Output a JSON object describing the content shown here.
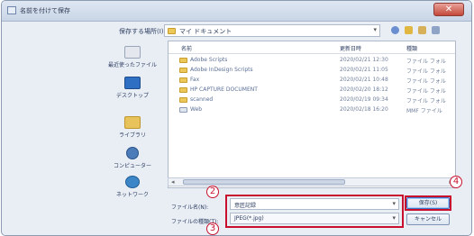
{
  "dialog": {
    "title": "名前を付けて保存",
    "close_label": "✕"
  },
  "toolbar": {
    "save_in_label": "保存する場所(I):",
    "location": "マイ ドキュメント",
    "icons": [
      "back-icon",
      "up-folder-icon",
      "new-folder-icon",
      "views-icon"
    ]
  },
  "places": [
    {
      "icon": "recent-icon",
      "label": "最近使ったファイル"
    },
    {
      "icon": "desktop-icon",
      "label": "デスクトップ"
    },
    {
      "icon": "library-icon",
      "label": "ライブラリ"
    },
    {
      "icon": "computer-icon",
      "label": "コンピューター"
    },
    {
      "icon": "network-icon",
      "label": "ネットワーク"
    }
  ],
  "filelist": {
    "columns": {
      "name": "名前",
      "date": "更新日時",
      "type": "種類"
    },
    "rows": [
      {
        "name": "Adobe Scripts",
        "date": "2020/02/21 12:30",
        "type": "ファイル フォル"
      },
      {
        "name": "Adobe InDesign Scripts",
        "date": "2020/02/21 11:05",
        "type": "ファイル フォル"
      },
      {
        "name": "Fax",
        "date": "2020/02/21 10:48",
        "type": "ファイル フォル"
      },
      {
        "name": "HP CAPTURE DOCUMENT",
        "date": "2020/02/20 18:12",
        "type": "ファイル フォル"
      },
      {
        "name": "scanned",
        "date": "2020/02/19 09:34",
        "type": "ファイル フォル"
      },
      {
        "name": "Web",
        "date": "2020/02/18 16:20",
        "type": "MMF ファイル"
      }
    ]
  },
  "form": {
    "filename_label": "ファイル名(N):",
    "filename_value": "意匠記録",
    "filetype_label": "ファイルの種類(T):",
    "filetype_value": "JPEG(*.jpg)",
    "save_label": "保存(S)",
    "cancel_label": "キャンセル"
  },
  "callouts": {
    "c2": "2",
    "c3": "3",
    "c4": "4"
  },
  "colors": {
    "highlight": "#c8102e",
    "accent": "#3f76c9"
  }
}
